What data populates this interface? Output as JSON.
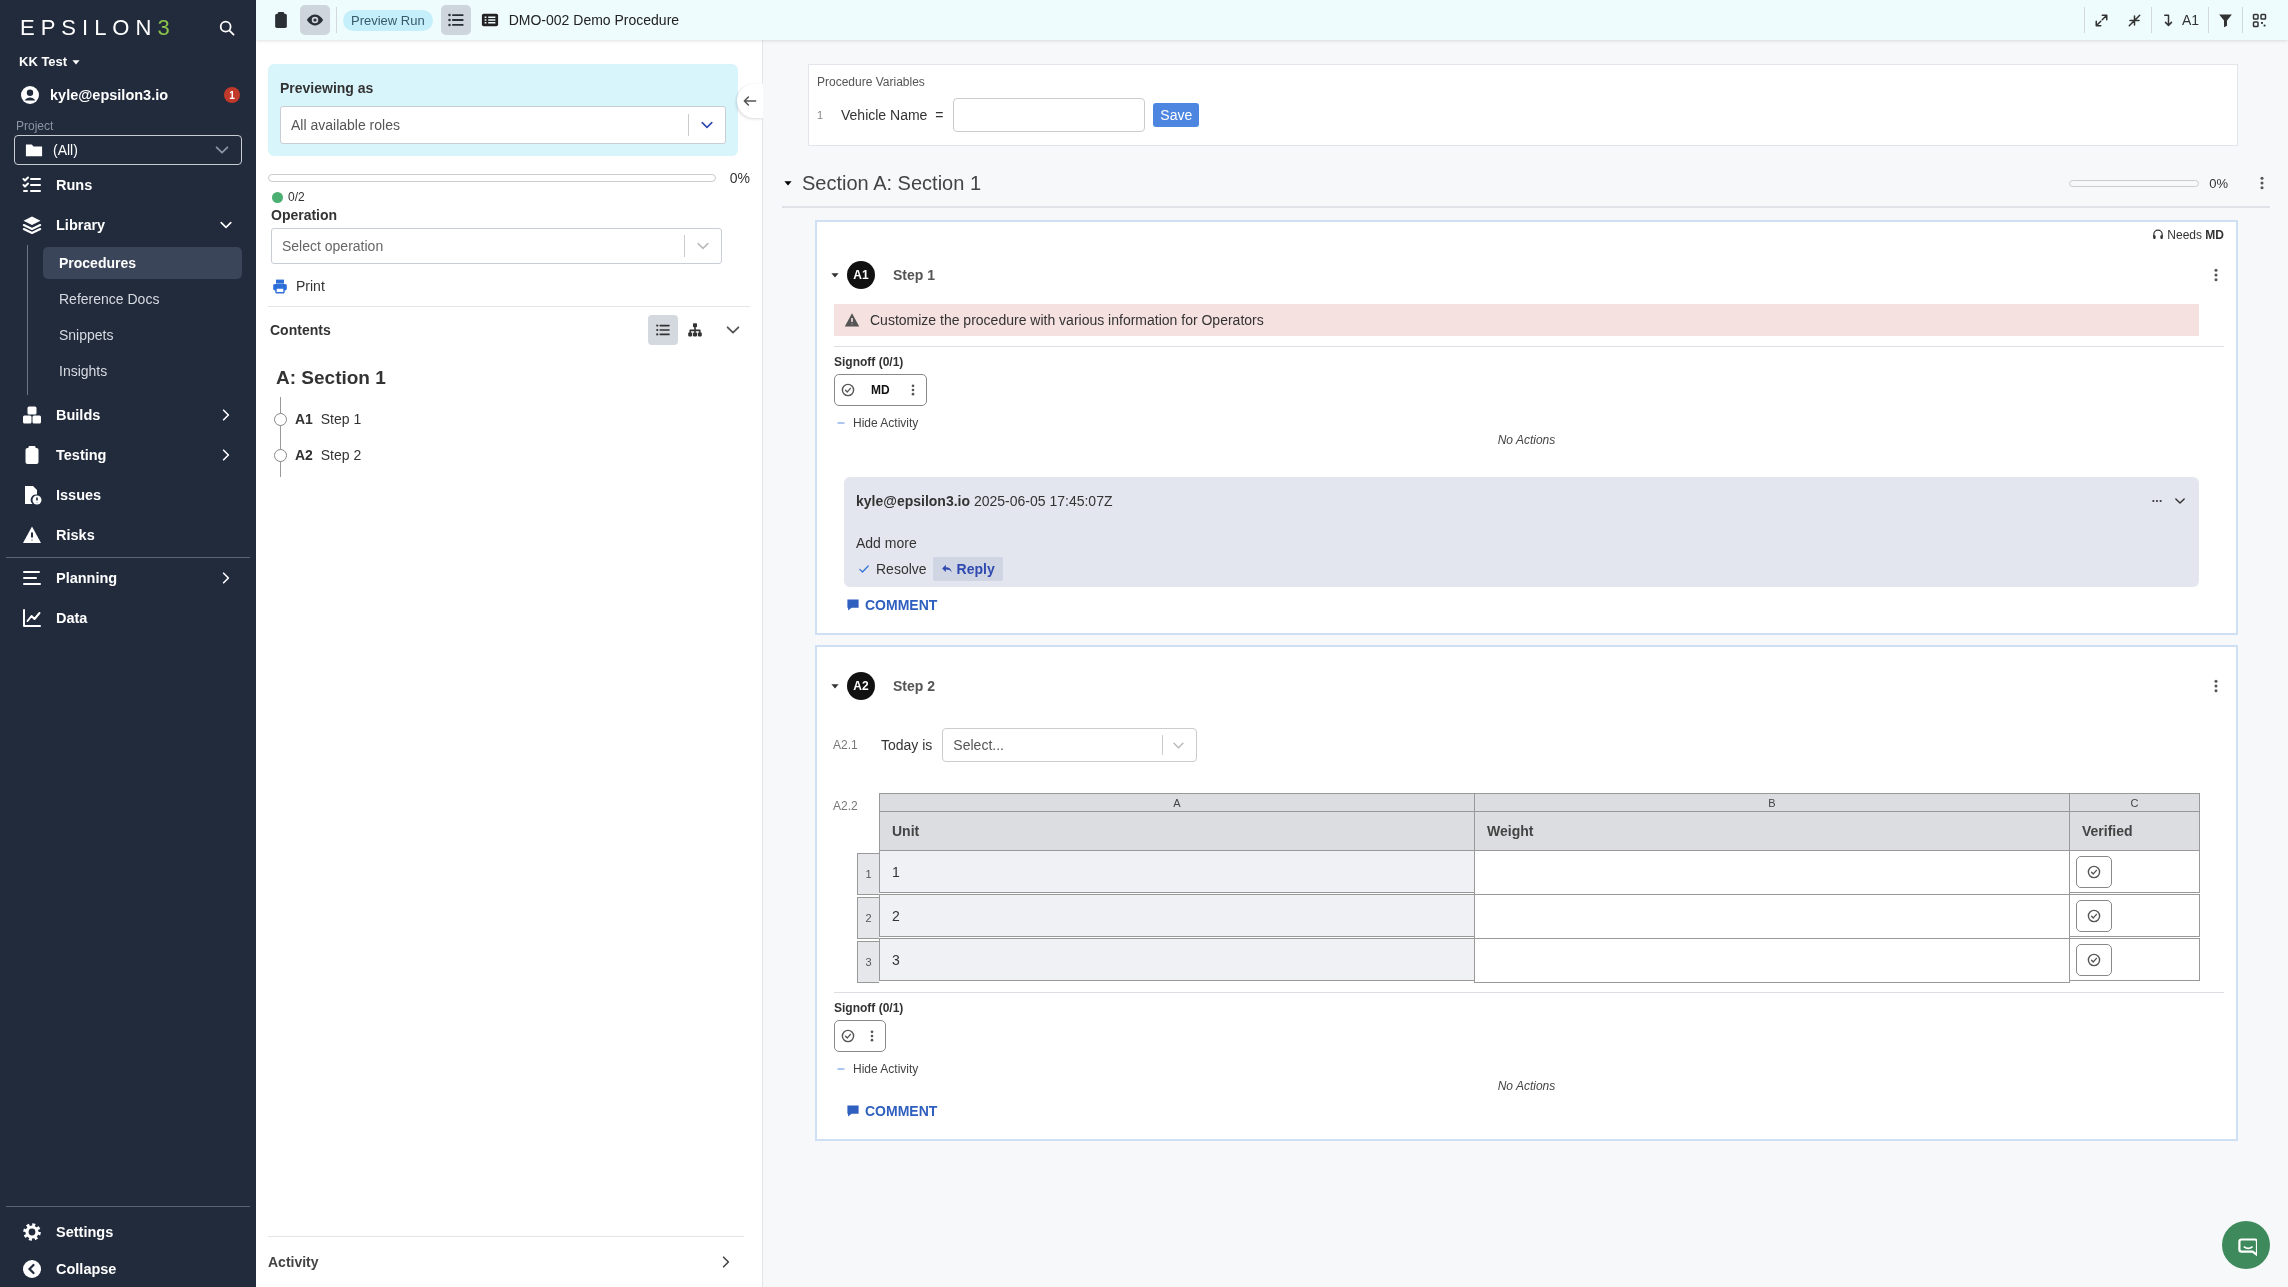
{
  "sidebar": {
    "logo_letters": "EPSILON",
    "logo_mark": "3",
    "workspace": "KK Test",
    "user": "kyle@epsilon3.io",
    "notifications": "1",
    "project_label": "Project",
    "project_value": "(All)",
    "nav_groups": [
      {
        "items": [
          {
            "label": "Runs",
            "kind": "link"
          },
          {
            "label": "Library",
            "kind": "group",
            "expanded": true,
            "children": [
              {
                "label": "Procedures",
                "selected": true
              },
              {
                "label": "Reference Docs",
                "selected": false
              },
              {
                "label": "Snippets",
                "selected": false
              },
              {
                "label": "Insights",
                "selected": false
              }
            ]
          },
          {
            "label": "Builds",
            "kind": "group",
            "expanded": false
          },
          {
            "label": "Testing",
            "kind": "group",
            "expanded": false
          },
          {
            "label": "Issues",
            "kind": "link"
          },
          {
            "label": "Risks",
            "kind": "link"
          }
        ]
      },
      {
        "items": [
          {
            "label": "Planning",
            "kind": "group",
            "expanded": false
          },
          {
            "label": "Data",
            "kind": "link"
          }
        ]
      }
    ],
    "footer": [
      {
        "label": "Settings"
      },
      {
        "label": "Collapse"
      }
    ]
  },
  "top_bar": {
    "tools": [
      {
        "kind": "clipboard",
        "selected": false
      },
      {
        "kind": "preview",
        "selected": true
      }
    ],
    "badge": "Preview Run",
    "outline_toggle": {
      "selected": true
    },
    "title": "DMO-002 Demo Procedure",
    "jump": "A1"
  },
  "panel": {
    "title": "Previewing as",
    "role": "All available roles",
    "progress": {
      "level": 0,
      "percent": "0%"
    },
    "status_count": "0/2",
    "operation_label": "Operation",
    "operation_placeholder": "Select operation",
    "print": "Print",
    "contents": "Contents",
    "view_modes": [
      {
        "kind": "list",
        "selected": true
      },
      {
        "kind": "tree",
        "selected": false
      }
    ],
    "section": "A: Section 1",
    "outline": [
      {
        "key": "A1",
        "title": "Step 1",
        "completed": false
      },
      {
        "key": "A2",
        "title": "Step 2",
        "completed": false
      }
    ],
    "activity": "Activity"
  },
  "main": {
    "variables": {
      "title": "Procedure Variables",
      "items": [
        {
          "number": "1",
          "name": "Vehicle Name",
          "operator": "="
        }
      ],
      "save": "Save"
    },
    "section": {
      "title": "Section A: Section 1",
      "expanded": true,
      "level": 0,
      "percent": "0%"
    },
    "steps": [
      {
        "key": "A1",
        "title": "Step 1",
        "expanded": true,
        "requirement": {
          "label": "Needs",
          "role": "MD"
        },
        "blocks": [
          {
            "kind": "warning",
            "text": "Customize the procedure with various information for Operators"
          }
        ],
        "signoff": {
          "title": "Signoff (0/1)",
          "roles": [
            "MD"
          ],
          "checked": false
        },
        "activity_toggle": "Hide Activity",
        "no_actions": "No Actions",
        "comments": [
          {
            "author": "kyle@epsilon3.io",
            "time": "2025-06-05 17:45:07Z",
            "body": "Add more",
            "resolve": "Resolve",
            "reply": "Reply"
          }
        ],
        "comment_button": "COMMENT"
      },
      {
        "key": "A2",
        "title": "Step 2",
        "expanded": true,
        "blocks": [
          {
            "kind": "select",
            "index": "A2.1",
            "label": "Today is",
            "placeholder": "Select..."
          },
          {
            "kind": "table",
            "index": "A2.2",
            "column_letters": [
              "A",
              "B",
              "C"
            ],
            "columns": [
              "Unit",
              "Weight",
              "Verified"
            ],
            "rows": [
              {
                "number": "1",
                "unit": "1",
                "verified": false
              },
              {
                "number": "2",
                "unit": "2",
                "verified": false
              },
              {
                "number": "3",
                "unit": "3",
                "verified": false
              }
            ]
          }
        ],
        "signoff": {
          "title": "Signoff (0/1)",
          "checked": false
        },
        "activity_toggle": "Hide Activity",
        "no_actions": "No Actions",
        "comment_button": "COMMENT"
      }
    ]
  }
}
